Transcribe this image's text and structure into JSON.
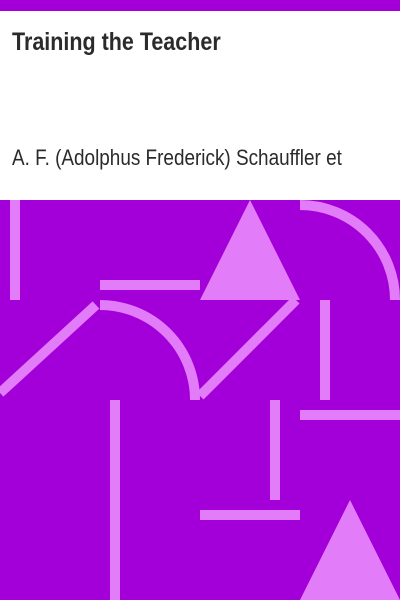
{
  "book": {
    "title": "Training the Teacher",
    "author": "A. F. (Adolphus Frederick) Schauffler et"
  },
  "colors": {
    "accent": "#a300d9",
    "pattern_shape": "#e27cf8",
    "text": "#2b2b2b",
    "background": "#ffffff"
  }
}
